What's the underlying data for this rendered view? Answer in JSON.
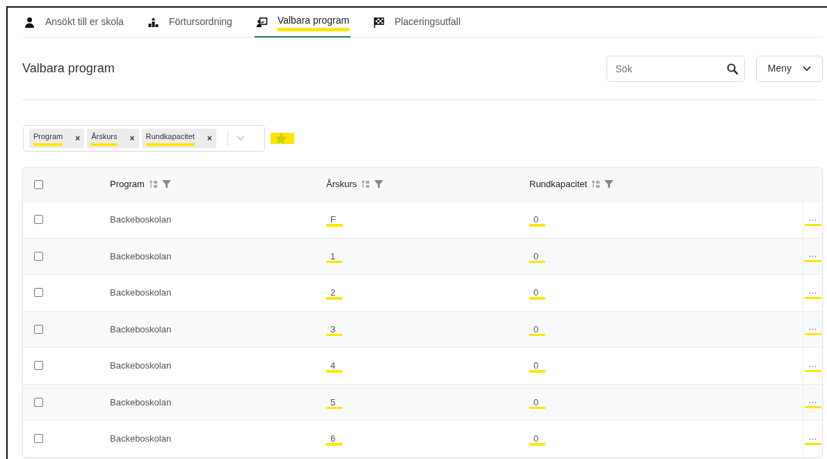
{
  "tabs": [
    {
      "label": "Ansökt till er skola",
      "selected": false,
      "highlighted": false
    },
    {
      "label": "Förtursordning",
      "selected": false,
      "highlighted": false
    },
    {
      "label": "Valbara program",
      "selected": true,
      "highlighted": true
    },
    {
      "label": "Placeringsutfall",
      "selected": false,
      "highlighted": false
    }
  ],
  "page_title": "Valbara program",
  "search": {
    "placeholder": "Sök"
  },
  "menu_button": "Meny",
  "column_chips": [
    {
      "label": "Program",
      "remove": "×",
      "highlighted": true
    },
    {
      "label": "Årskurs",
      "remove": "×",
      "highlighted": true
    },
    {
      "label": "Rundkapacitet",
      "remove": "×",
      "highlighted": true
    }
  ],
  "favorite_highlighted": true,
  "table": {
    "select_all_checked": false,
    "columns": [
      "Program",
      "Årskurs",
      "Rundkapacitet"
    ],
    "rows": [
      {
        "checked": false,
        "program": "Backeboskolan",
        "arskurs": "F",
        "rundkapacitet": "0",
        "actions": "···",
        "highlighted": true
      },
      {
        "checked": false,
        "program": "Backeboskolan",
        "arskurs": "1",
        "rundkapacitet": "0",
        "actions": "···",
        "highlighted": true
      },
      {
        "checked": false,
        "program": "Backeboskolan",
        "arskurs": "2",
        "rundkapacitet": "0",
        "actions": "···",
        "highlighted": true
      },
      {
        "checked": false,
        "program": "Backeboskolan",
        "arskurs": "3",
        "rundkapacitet": "0",
        "actions": "···",
        "highlighted": true
      },
      {
        "checked": false,
        "program": "Backeboskolan",
        "arskurs": "4",
        "rundkapacitet": "0",
        "actions": "···",
        "highlighted": true
      },
      {
        "checked": false,
        "program": "Backeboskolan",
        "arskurs": "5",
        "rundkapacitet": "0",
        "actions": "···",
        "highlighted": true
      },
      {
        "checked": false,
        "program": "Backeboskolan",
        "arskurs": "6",
        "rundkapacitet": "0",
        "actions": "···",
        "highlighted": true
      }
    ]
  }
}
